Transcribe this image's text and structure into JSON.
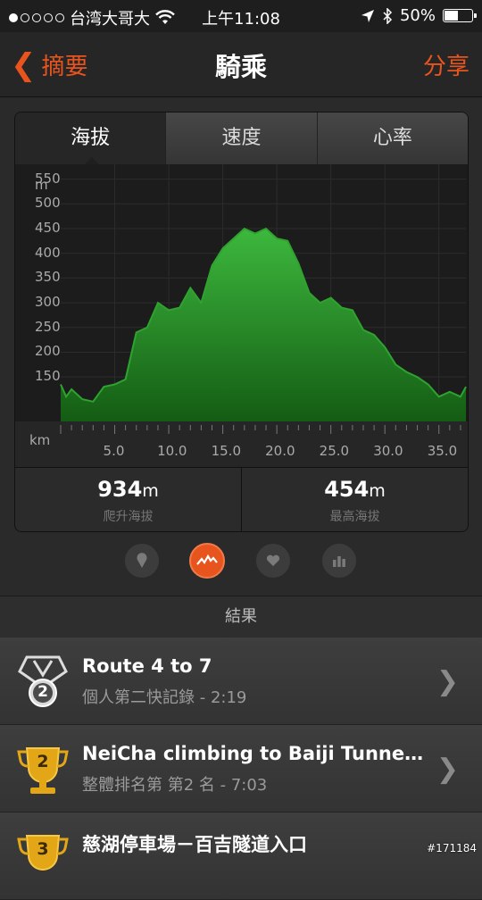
{
  "status_bar": {
    "carrier": "台湾大哥大",
    "time": "上午11:08",
    "battery": "50%",
    "battery_level": 0.5,
    "signal_bars": 1
  },
  "nav": {
    "back_label": "摘要",
    "title": "騎乘",
    "share_label": "分享"
  },
  "tabs": [
    {
      "label": "海拔",
      "active": true
    },
    {
      "label": "速度",
      "active": false
    },
    {
      "label": "心率",
      "active": false
    }
  ],
  "chart_data": {
    "type": "area",
    "y_unit": "m",
    "x_unit": "km",
    "y_ticks": [
      "550",
      "500",
      "450",
      "400",
      "350",
      "300",
      "250",
      "200",
      "150"
    ],
    "x_ticks": [
      "5.0",
      "10.0",
      "15.0",
      "20.0",
      "25.0",
      "30.0",
      "35.0"
    ],
    "xlim": [
      0,
      37.5
    ],
    "ylim": [
      60,
      580
    ],
    "x": [
      0,
      0.5,
      1,
      2,
      3,
      4,
      5,
      6,
      7,
      8,
      9,
      10,
      11,
      12,
      13,
      14,
      15,
      16,
      17,
      18,
      19,
      20,
      21,
      22,
      23,
      24,
      25,
      26,
      27,
      28,
      29,
      30,
      31,
      32,
      33,
      34,
      35,
      36,
      37,
      37.5
    ],
    "y": [
      135,
      110,
      125,
      105,
      100,
      130,
      135,
      145,
      240,
      250,
      300,
      285,
      290,
      330,
      300,
      375,
      410,
      430,
      450,
      440,
      450,
      430,
      425,
      380,
      320,
      300,
      310,
      290,
      285,
      245,
      235,
      210,
      175,
      160,
      150,
      135,
      110,
      120,
      110,
      130
    ],
    "color": "#2fa32f",
    "grid": true
  },
  "stats": [
    {
      "value": "934",
      "unit": "m",
      "label": "爬升海拔"
    },
    {
      "value": "454",
      "unit": "m",
      "label": "最高海拔"
    }
  ],
  "pager_icons": [
    "location-pin-icon",
    "elevation-icon",
    "heart-icon",
    "bar-chart-icon"
  ],
  "results_header": "結果",
  "results": [
    {
      "title": "Route 4 to 7",
      "subtitle": "個人第二快記錄 - 2:19",
      "badge": "2",
      "badge_type": "medal-silver"
    },
    {
      "title": "NeiCha climbing to Baiji Tunne…",
      "subtitle": "整體排名第 第2 名 - 7:03",
      "badge": "2",
      "badge_type": "trophy-gold"
    },
    {
      "title": "慈湖停車場－百吉隧道入口",
      "subtitle": "",
      "badge": "3",
      "badge_type": "trophy-gold"
    }
  ],
  "accent_color": "#e8541e",
  "watermark": "#171184"
}
